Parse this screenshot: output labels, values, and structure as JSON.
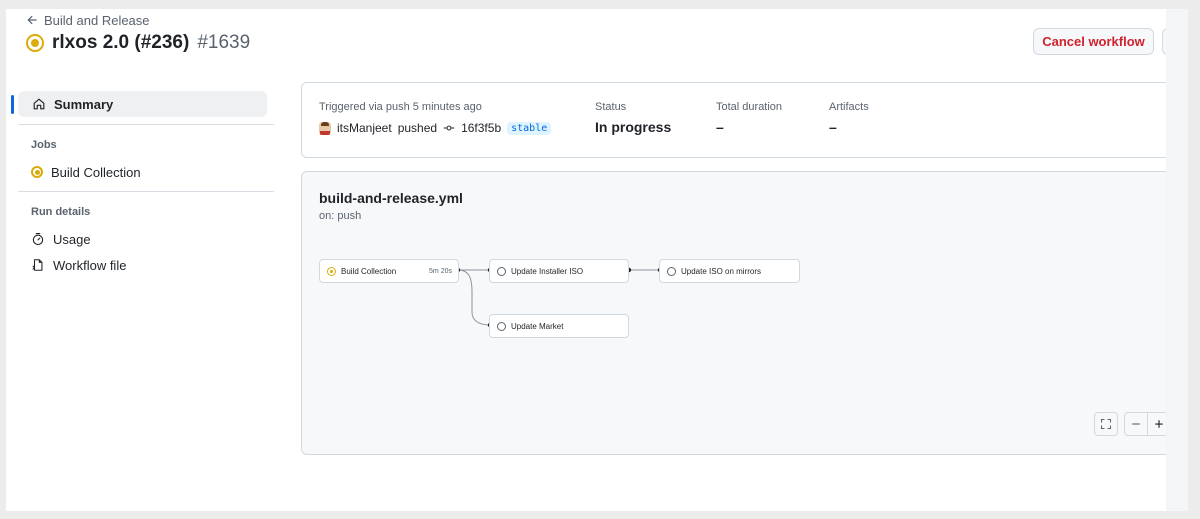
{
  "header": {
    "back_label": "Build and Release",
    "run_name": "rlxos 2.0 (#236)",
    "run_number": "#1639",
    "cancel_label": "Cancel workflow"
  },
  "sidebar": {
    "summary_label": "Summary",
    "jobs_heading": "Jobs",
    "jobs": [
      {
        "label": "Build Collection",
        "status": "in-progress"
      }
    ],
    "run_details_heading": "Run details",
    "run_details": [
      {
        "label": "Usage",
        "icon": "stopwatch-icon"
      },
      {
        "label": "Workflow file",
        "icon": "file-icon"
      }
    ]
  },
  "summary": {
    "trigger_label": "Triggered via push 5 minutes ago",
    "actor": "itsManjeet",
    "action": "pushed",
    "commit": "16f3f5b",
    "branch": "stable",
    "status_label": "Status",
    "status_value": "In progress",
    "duration_label": "Total duration",
    "duration_value": "–",
    "artifacts_label": "Artifacts",
    "artifacts_value": "–"
  },
  "graph": {
    "file_name": "build-and-release.yml",
    "trigger": "on: push",
    "jobs": [
      {
        "name": "Build Collection",
        "time": "5m 20s",
        "status": "in-progress"
      },
      {
        "name": "Update Installer ISO",
        "status": "pending"
      },
      {
        "name": "Update ISO on mirrors",
        "status": "pending"
      },
      {
        "name": "Update Market",
        "status": "pending"
      }
    ]
  },
  "colors": {
    "in_progress": "#dbab0a",
    "danger": "#cf222e",
    "accent": "#0969da"
  }
}
